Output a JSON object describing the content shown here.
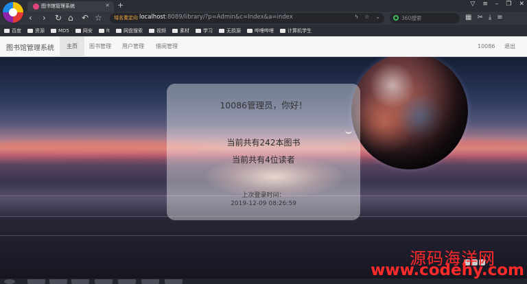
{
  "browser": {
    "tab_title": "图书馆管理系统",
    "tab_close": "×",
    "new_tab": "+",
    "redirect_badge": "域名重定向",
    "url_host": "localhost",
    "url_rest": ":8089/library/?p=Admin&c=Index&a=index",
    "search_placeholder": "360搜索",
    "bookmarks": [
      "百度",
      "资源",
      "MD5",
      "网安",
      "ft",
      "网盘搜索",
      "视频",
      "素材",
      "学习",
      "无损源",
      "哔哩哔哩",
      "计算机学生"
    ]
  },
  "app": {
    "brand": "图书馆管理系统",
    "nav": [
      "主页",
      "图书管理",
      "用户管理",
      "借阅管理"
    ],
    "user": "10086",
    "logout": "退出"
  },
  "card": {
    "greeting": "10086管理员，你好！",
    "books_stat": "当前共有242本图书",
    "readers_stat": "当前共有4位读者",
    "last_login_label": "上次登录时间：",
    "last_login_time": "2019-12-09 08:26:59"
  },
  "watermark": {
    "line1": "源码海洋网",
    "line2": "www.codehy.com"
  }
}
